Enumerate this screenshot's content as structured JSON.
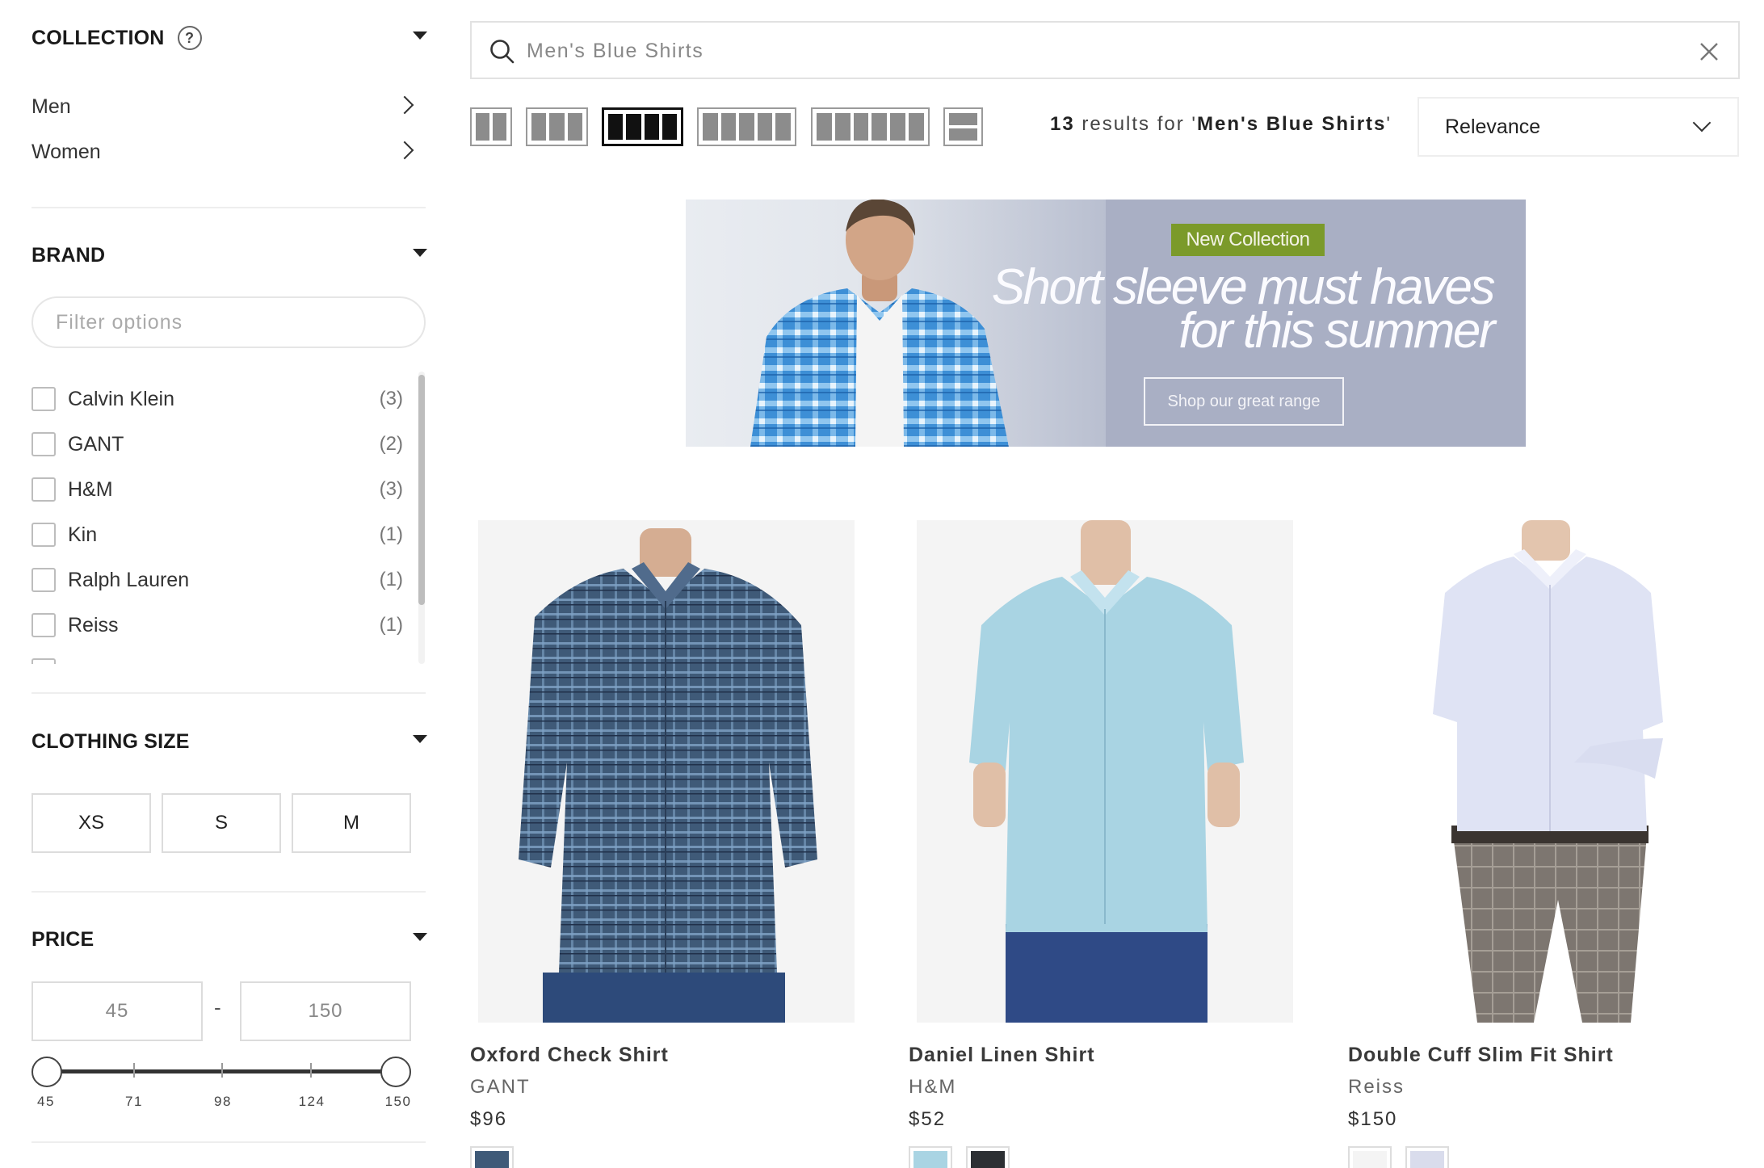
{
  "sidebar": {
    "collection": {
      "title": "COLLECTION",
      "help": "?",
      "items": [
        {
          "label": "Men"
        },
        {
          "label": "Women"
        }
      ]
    },
    "brand": {
      "title": "BRAND",
      "filter_placeholder": "Filter options",
      "items": [
        {
          "label": "Calvin Klein",
          "count": "(3)"
        },
        {
          "label": "GANT",
          "count": "(2)"
        },
        {
          "label": "H&M",
          "count": "(3)"
        },
        {
          "label": "Kin",
          "count": "(1)"
        },
        {
          "label": "Ralph Lauren",
          "count": "(1)"
        },
        {
          "label": "Reiss",
          "count": "(1)"
        }
      ]
    },
    "clothing_size": {
      "title": "CLOTHING SIZE",
      "sizes": [
        "XS",
        "S",
        "M"
      ]
    },
    "price": {
      "title": "PRICE",
      "min": "45",
      "max": "150",
      "separator": "-",
      "ticks": [
        "45",
        "71",
        "98",
        "124",
        "150"
      ]
    }
  },
  "search": {
    "placeholder": "Men's Blue Shirts",
    "value": ""
  },
  "toolbar": {
    "layout_options": [
      "2-column-grid",
      "3-column-grid",
      "4-column-grid",
      "5-column-grid",
      "6-column-grid",
      "list-view"
    ],
    "active_layout": "4-column-grid",
    "results_count": "13",
    "results_prefix": " results for '",
    "results_query": "Men's Blue Shirts",
    "results_suffix": "'",
    "sort_label": "Relevance"
  },
  "banner": {
    "tag": "New Collection",
    "headline_line1": "Short sleeve must haves",
    "headline_line2": "for this summer",
    "cta": "Shop our great range"
  },
  "products": [
    {
      "name": "Oxford Check Shirt",
      "brand": "GANT",
      "price": "$96",
      "swatches": [
        "#3f5a78"
      ]
    },
    {
      "name": "Daniel Linen Shirt",
      "brand": "H&M",
      "price": "$52",
      "swatches": [
        "#a9d4e3",
        "#2c2f33"
      ]
    },
    {
      "name": "Double Cuff Slim Fit Shirt",
      "brand": "Reiss",
      "price": "$150",
      "swatches": [
        "#f4f4f4",
        "#d9dcec"
      ]
    }
  ],
  "colors": {
    "banner_bg": "#a9afc4",
    "banner_tag": "#7b9a2a",
    "active_layout": "#111111"
  }
}
